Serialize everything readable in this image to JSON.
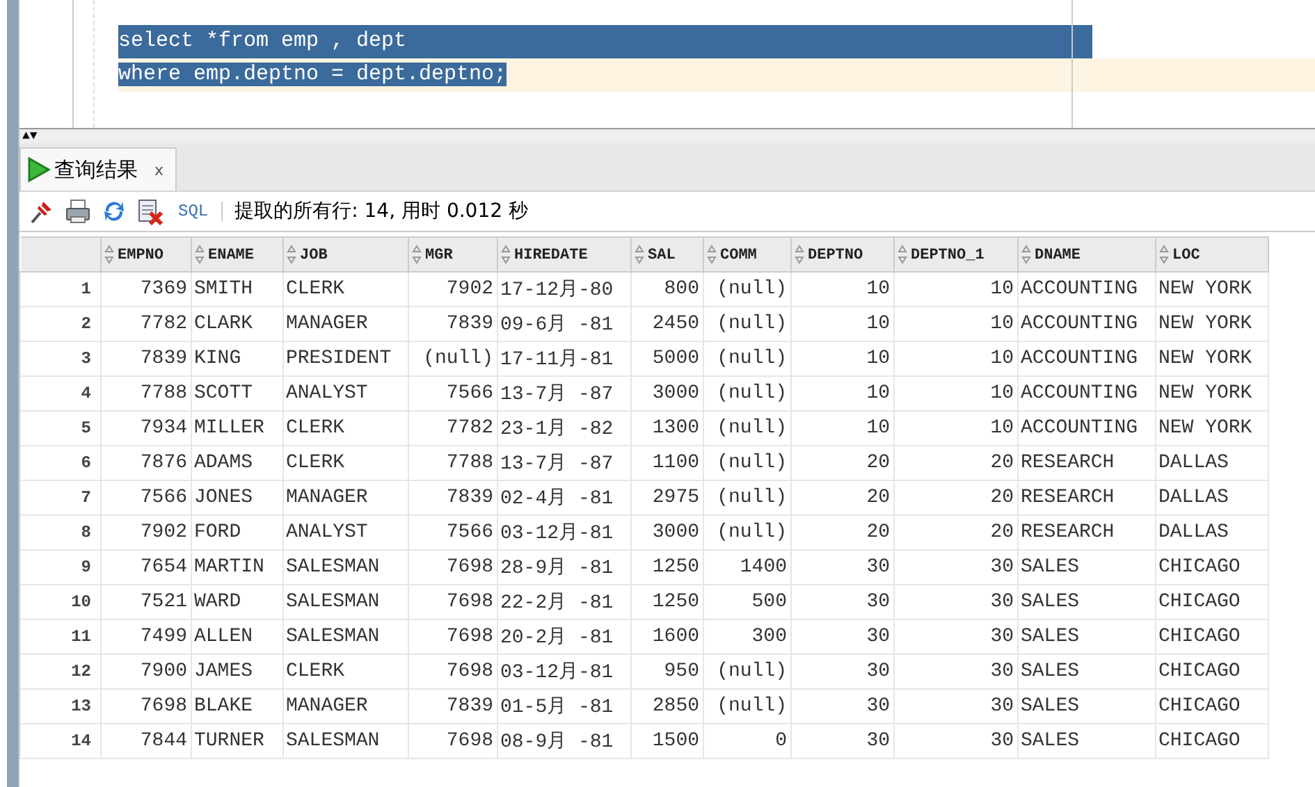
{
  "editor": {
    "lines": [
      {
        "text": "select *from emp , dept",
        "selected": true,
        "current": false
      },
      {
        "text": "where emp.deptno = dept.deptno;",
        "selected": true,
        "current": true
      }
    ]
  },
  "splitter": {
    "collapse": "▲",
    "expand": "▼"
  },
  "tabs": [
    {
      "label": "查询结果",
      "close": "x",
      "selected": true
    }
  ],
  "toolbar": {
    "sql_link": "SQL",
    "status": "提取的所有行: 14, 用时 0.012 秒"
  },
  "table": {
    "columns": [
      {
        "label": "EMPNO",
        "kind": "number"
      },
      {
        "label": "ENAME",
        "kind": "text"
      },
      {
        "label": "JOB",
        "kind": "text"
      },
      {
        "label": "MGR",
        "kind": "number"
      },
      {
        "label": "HIREDATE",
        "kind": "text"
      },
      {
        "label": "SAL",
        "kind": "number"
      },
      {
        "label": "COMM",
        "kind": "number"
      },
      {
        "label": "DEPTNO",
        "kind": "number"
      },
      {
        "label": "DEPTNO_1",
        "kind": "number"
      },
      {
        "label": "DNAME",
        "kind": "text"
      },
      {
        "label": "LOC",
        "kind": "text"
      }
    ],
    "rows": [
      {
        "number": "1",
        "cells": [
          "7369",
          "SMITH",
          "CLERK",
          "7902",
          "17-12月-80",
          "800",
          "(null)",
          "10",
          "10",
          "ACCOUNTING",
          "NEW YORK"
        ]
      },
      {
        "number": "2",
        "cells": [
          "7782",
          "CLARK",
          "MANAGER",
          "7839",
          "09-6月 -81",
          "2450",
          "(null)",
          "10",
          "10",
          "ACCOUNTING",
          "NEW YORK"
        ]
      },
      {
        "number": "3",
        "cells": [
          "7839",
          "KING",
          "PRESIDENT",
          "(null)",
          "17-11月-81",
          "5000",
          "(null)",
          "10",
          "10",
          "ACCOUNTING",
          "NEW YORK"
        ]
      },
      {
        "number": "4",
        "cells": [
          "7788",
          "SCOTT",
          "ANALYST",
          "7566",
          "13-7月 -87",
          "3000",
          "(null)",
          "10",
          "10",
          "ACCOUNTING",
          "NEW YORK"
        ]
      },
      {
        "number": "5",
        "cells": [
          "7934",
          "MILLER",
          "CLERK",
          "7782",
          "23-1月 -82",
          "1300",
          "(null)",
          "10",
          "10",
          "ACCOUNTING",
          "NEW YORK"
        ]
      },
      {
        "number": "6",
        "cells": [
          "7876",
          "ADAMS",
          "CLERK",
          "7788",
          "13-7月 -87",
          "1100",
          "(null)",
          "20",
          "20",
          "RESEARCH",
          "DALLAS"
        ]
      },
      {
        "number": "7",
        "cells": [
          "7566",
          "JONES",
          "MANAGER",
          "7839",
          "02-4月 -81",
          "2975",
          "(null)",
          "20",
          "20",
          "RESEARCH",
          "DALLAS"
        ]
      },
      {
        "number": "8",
        "cells": [
          "7902",
          "FORD",
          "ANALYST",
          "7566",
          "03-12月-81",
          "3000",
          "(null)",
          "20",
          "20",
          "RESEARCH",
          "DALLAS"
        ]
      },
      {
        "number": "9",
        "cells": [
          "7654",
          "MARTIN",
          "SALESMAN",
          "7698",
          "28-9月 -81",
          "1250",
          "1400",
          "30",
          "30",
          "SALES",
          "CHICAGO"
        ]
      },
      {
        "number": "10",
        "cells": [
          "7521",
          "WARD",
          "SALESMAN",
          "7698",
          "22-2月 -81",
          "1250",
          "500",
          "30",
          "30",
          "SALES",
          "CHICAGO"
        ]
      },
      {
        "number": "11",
        "cells": [
          "7499",
          "ALLEN",
          "SALESMAN",
          "7698",
          "20-2月 -81",
          "1600",
          "300",
          "30",
          "30",
          "SALES",
          "CHICAGO"
        ]
      },
      {
        "number": "12",
        "cells": [
          "7900",
          "JAMES",
          "CLERK",
          "7698",
          "03-12月-81",
          "950",
          "(null)",
          "30",
          "30",
          "SALES",
          "CHICAGO"
        ]
      },
      {
        "number": "13",
        "cells": [
          "7698",
          "BLAKE",
          "MANAGER",
          "7839",
          "01-5月 -81",
          "2850",
          "(null)",
          "30",
          "30",
          "SALES",
          "CHICAGO"
        ]
      },
      {
        "number": "14",
        "cells": [
          "7844",
          "TURNER",
          "SALESMAN",
          "7698",
          "08-9月 -81",
          "1500",
          "0",
          "30",
          "30",
          "SALES",
          "CHICAGO"
        ]
      }
    ]
  }
}
